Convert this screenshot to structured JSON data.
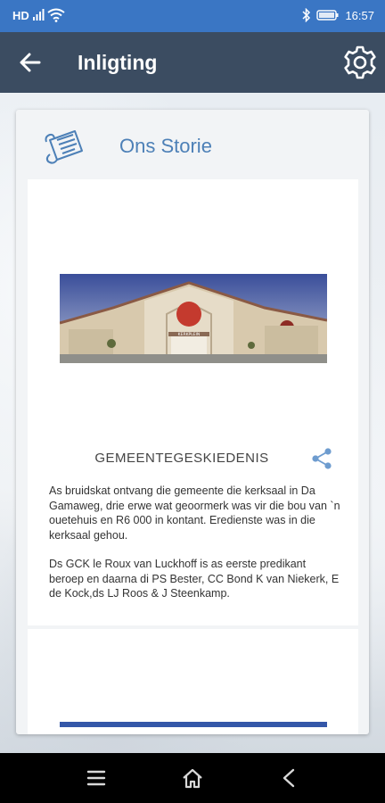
{
  "status": {
    "network": "HD",
    "time": "16:57"
  },
  "appbar": {
    "title": "Inligting"
  },
  "card": {
    "title": "Ons Storie"
  },
  "photo": {
    "sign_text": "KERKPLEIN"
  },
  "article": {
    "heading": "GEMEENTEGESKIEDENIS",
    "paragraphs": [
      "As bruidskat ontvang die gemeente die kerksaal in Da Gamaweg, drie erwe wat geoormerk was vir die bou van `n ouetehuis en R6 000 in kontant. Eredienste was in die kerksaal gehou.",
      "Ds GCK le Roux van Luckhoff is as eerste predikant beroep en daarna di PS Bester, CC Bond K van Niekerk, E de Kock,ds LJ Roos & J Steenkamp."
    ]
  },
  "colors": {
    "statusbar": "#3a76c4",
    "appbar": "#3b4c61",
    "accent": "#4d80b7"
  }
}
